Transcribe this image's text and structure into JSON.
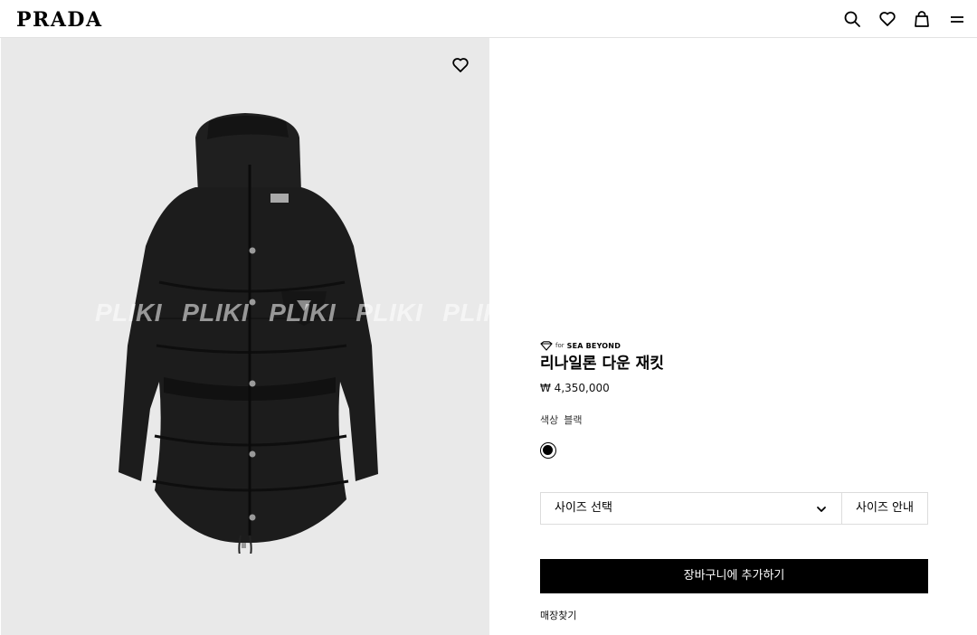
{
  "header": {
    "logo": "PRADA",
    "icons": [
      "search-icon",
      "heart-icon",
      "bag-icon",
      "menu-icon"
    ]
  },
  "image": {
    "watermark": [
      "PLIKI",
      "PLIKI",
      "PLIKI",
      "PLIKI",
      "PLIKI"
    ],
    "wishlist_icon": "heart-icon"
  },
  "product": {
    "badge_for": "for",
    "badge_brand": "SEA BEYOND",
    "title": "리나일론 다운 재킷",
    "price": "₩ 4,350,000",
    "color_label": "색상",
    "color_value": "블랙",
    "swatch_color": "#000000"
  },
  "size": {
    "select_label": "사이즈 선택",
    "guide_label": "사이즈 안내"
  },
  "actions": {
    "add_to_cart": "장바구니에 추가하기",
    "find_store": "매장찾기"
  }
}
